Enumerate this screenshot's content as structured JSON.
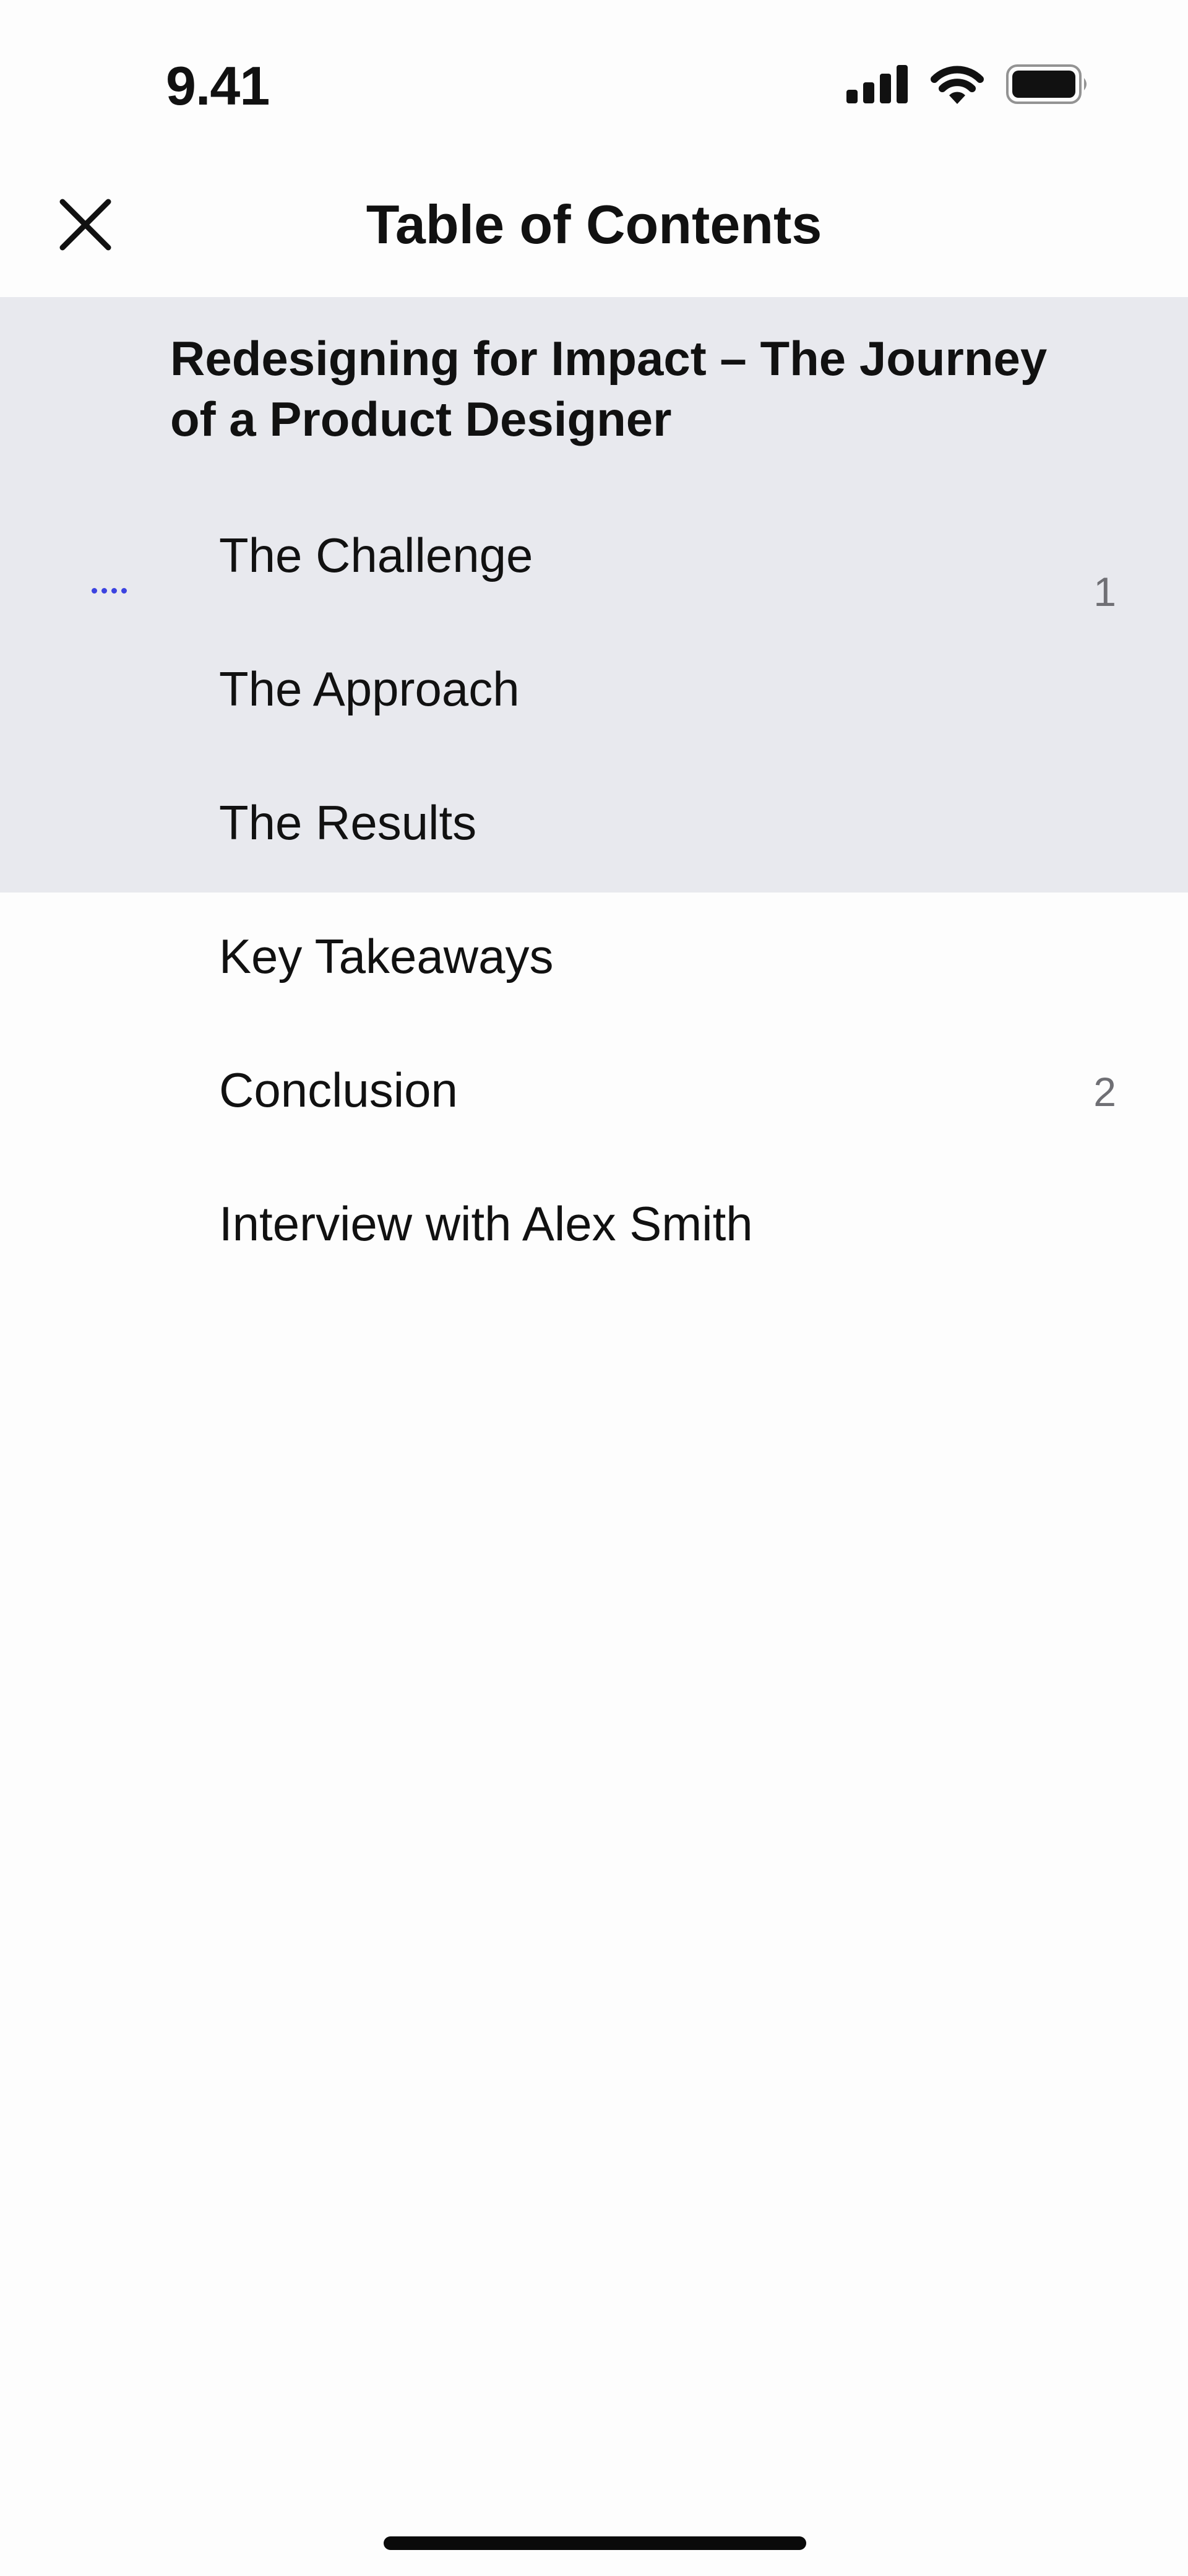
{
  "status_bar": {
    "time": "9.41",
    "icons": [
      "cellular-signal-icon",
      "wifi-icon",
      "battery-icon"
    ]
  },
  "header": {
    "title": "Table of Contents",
    "close_icon": "close-icon"
  },
  "toc": {
    "book_title": "Redesigning for Impact – The Journey of a Product Designer",
    "current_group_pages": "1",
    "items": [
      {
        "label": "The Challenge"
      },
      {
        "label": "The Approach"
      },
      {
        "label": "The Results"
      },
      {
        "label": "Key Takeaways"
      },
      {
        "label": "Conclusion",
        "page": "2"
      },
      {
        "label": "Interview with Alex Smith"
      }
    ]
  },
  "colors": {
    "highlight_bg": "#e8e9ee",
    "accent": "#3c43e0",
    "page_number": "#6f6f74"
  }
}
